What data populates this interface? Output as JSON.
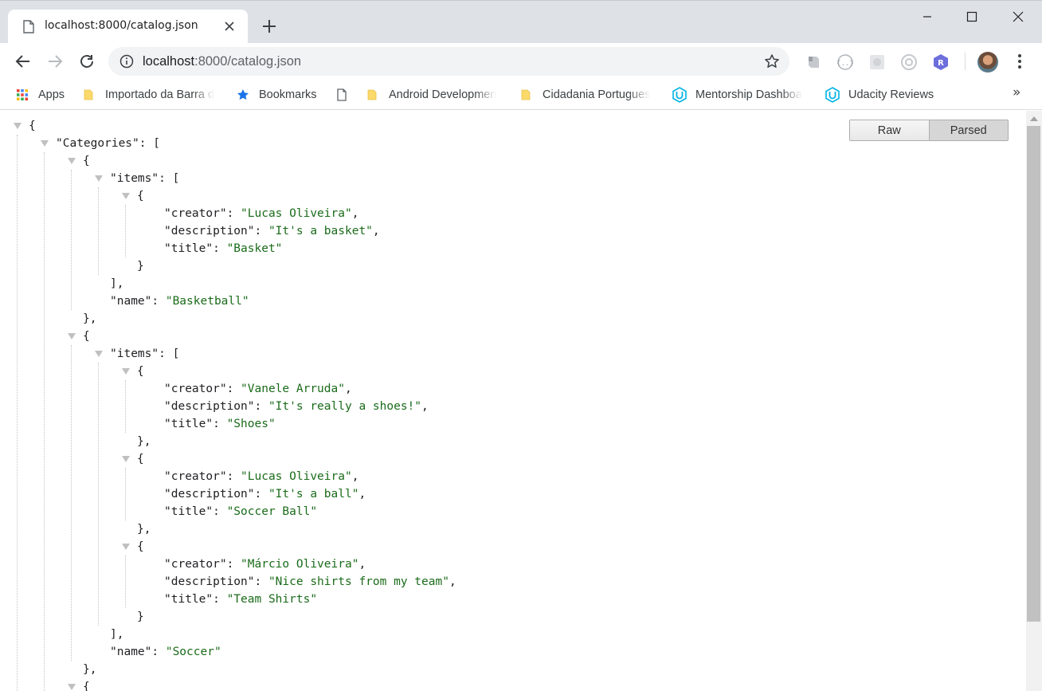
{
  "tab": {
    "title": "localhost:8000/catalog.json"
  },
  "omnibox": {
    "host": "localhost",
    "path": ":8000/catalog.json"
  },
  "extensions": [
    "evernote-icon",
    "json-viewer-icon",
    "extension-icon",
    "chromecast-icon",
    "r-extension-icon"
  ],
  "bookmarks": [
    {
      "label": "Apps",
      "icon": "apps-grid-icon"
    },
    {
      "label": "Importado da Barra d",
      "icon": "folder-icon"
    },
    {
      "label": "Bookmarks",
      "icon": "star-icon"
    },
    {
      "label": "",
      "icon": "page-icon"
    },
    {
      "label": "Android Developmen",
      "icon": "folder-icon"
    },
    {
      "label": "Cidadania Portugues",
      "icon": "folder-icon"
    },
    {
      "label": "Mentorship Dashboa",
      "icon": "udacity-icon"
    },
    {
      "label": "Udacity Reviews",
      "icon": "udacity-icon"
    }
  ],
  "bookmarks_more": "»",
  "view_toggle": {
    "raw": "Raw",
    "parsed": "Parsed",
    "active": "parsed"
  },
  "json_lines": [
    {
      "depth": 0,
      "toggle": true,
      "text": "{"
    },
    {
      "depth": 1,
      "toggle": true,
      "key": "Categories",
      "text": "["
    },
    {
      "depth": 2,
      "toggle": true,
      "text": "{"
    },
    {
      "depth": 3,
      "toggle": true,
      "key": "items",
      "text": "["
    },
    {
      "depth": 4,
      "toggle": true,
      "text": "{"
    },
    {
      "depth": 5,
      "key": "creator",
      "value": "Lucas Oliveira",
      "comma": true
    },
    {
      "depth": 5,
      "key": "description",
      "value": "It's a basket",
      "comma": true
    },
    {
      "depth": 5,
      "key": "title",
      "value": "Basket"
    },
    {
      "depth": 4,
      "text": "}"
    },
    {
      "depth": 3,
      "text": "],"
    },
    {
      "depth": 3,
      "key": "name",
      "value": "Basketball"
    },
    {
      "depth": 2,
      "text": "},"
    },
    {
      "depth": 2,
      "toggle": true,
      "text": "{"
    },
    {
      "depth": 3,
      "toggle": true,
      "key": "items",
      "text": "["
    },
    {
      "depth": 4,
      "toggle": true,
      "text": "{"
    },
    {
      "depth": 5,
      "key": "creator",
      "value": "Vanele Arruda",
      "comma": true
    },
    {
      "depth": 5,
      "key": "description",
      "value": "It's really a shoes!",
      "comma": true
    },
    {
      "depth": 5,
      "key": "title",
      "value": "Shoes"
    },
    {
      "depth": 4,
      "text": "},"
    },
    {
      "depth": 4,
      "toggle": true,
      "text": "{"
    },
    {
      "depth": 5,
      "key": "creator",
      "value": "Lucas Oliveira",
      "comma": true
    },
    {
      "depth": 5,
      "key": "description",
      "value": "It's a ball",
      "comma": true
    },
    {
      "depth": 5,
      "key": "title",
      "value": "Soccer Ball"
    },
    {
      "depth": 4,
      "text": "},"
    },
    {
      "depth": 4,
      "toggle": true,
      "text": "{"
    },
    {
      "depth": 5,
      "key": "creator",
      "value": "Márcio Oliveira",
      "comma": true
    },
    {
      "depth": 5,
      "key": "description",
      "value": "Nice shirts from my team",
      "comma": true
    },
    {
      "depth": 5,
      "key": "title",
      "value": "Team Shirts"
    },
    {
      "depth": 4,
      "text": "}"
    },
    {
      "depth": 3,
      "text": "],"
    },
    {
      "depth": 3,
      "key": "name",
      "value": "Soccer"
    },
    {
      "depth": 2,
      "text": "},"
    },
    {
      "depth": 2,
      "toggle": true,
      "text": "{"
    }
  ]
}
